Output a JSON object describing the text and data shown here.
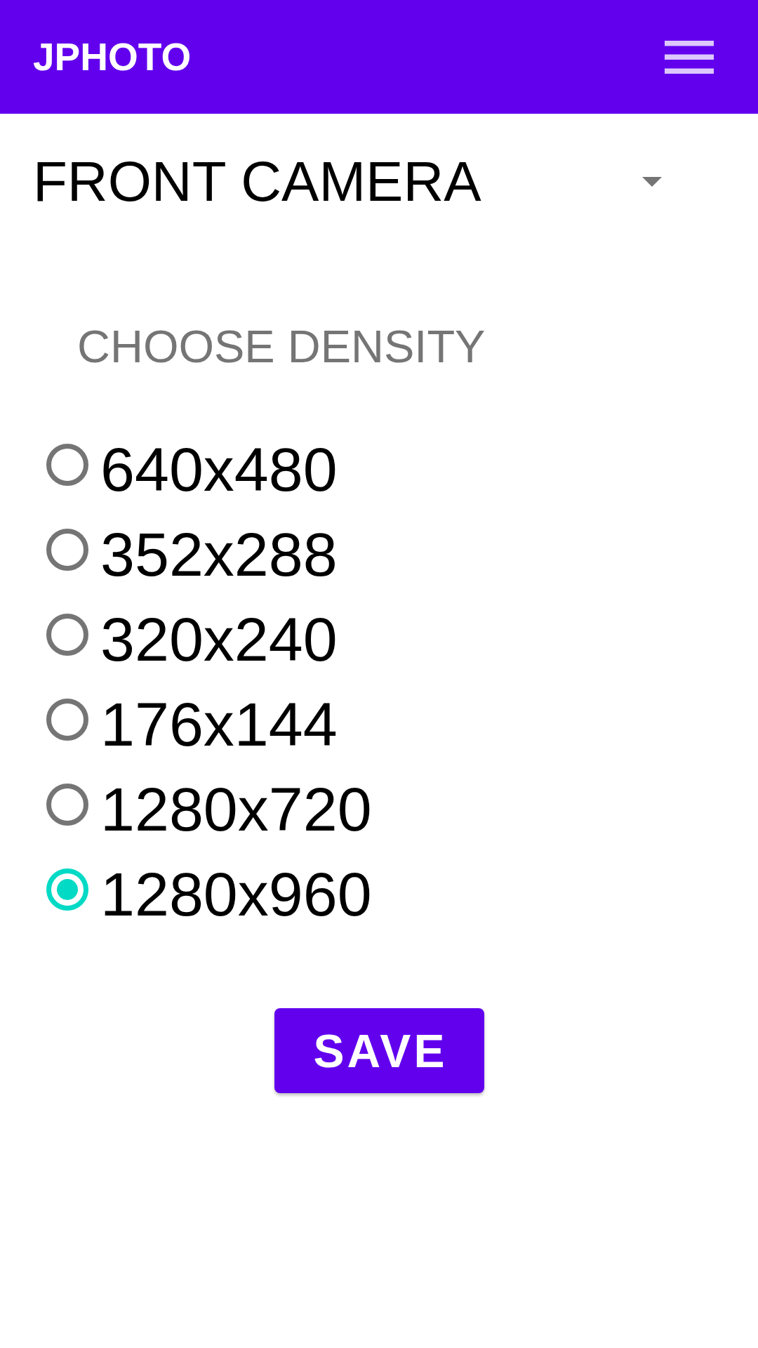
{
  "app_bar": {
    "title": "JPHOTO"
  },
  "camera_dropdown": {
    "value": "FRONT CAMERA"
  },
  "density": {
    "heading": "CHOOSE DENSITY",
    "options": [
      {
        "label": "640x480",
        "selected": false
      },
      {
        "label": "352x288",
        "selected": false
      },
      {
        "label": "320x240",
        "selected": false
      },
      {
        "label": "176x144",
        "selected": false
      },
      {
        "label": "1280x720",
        "selected": false
      },
      {
        "label": "1280x960",
        "selected": true
      }
    ]
  },
  "save_button": {
    "label": "SAVE"
  }
}
